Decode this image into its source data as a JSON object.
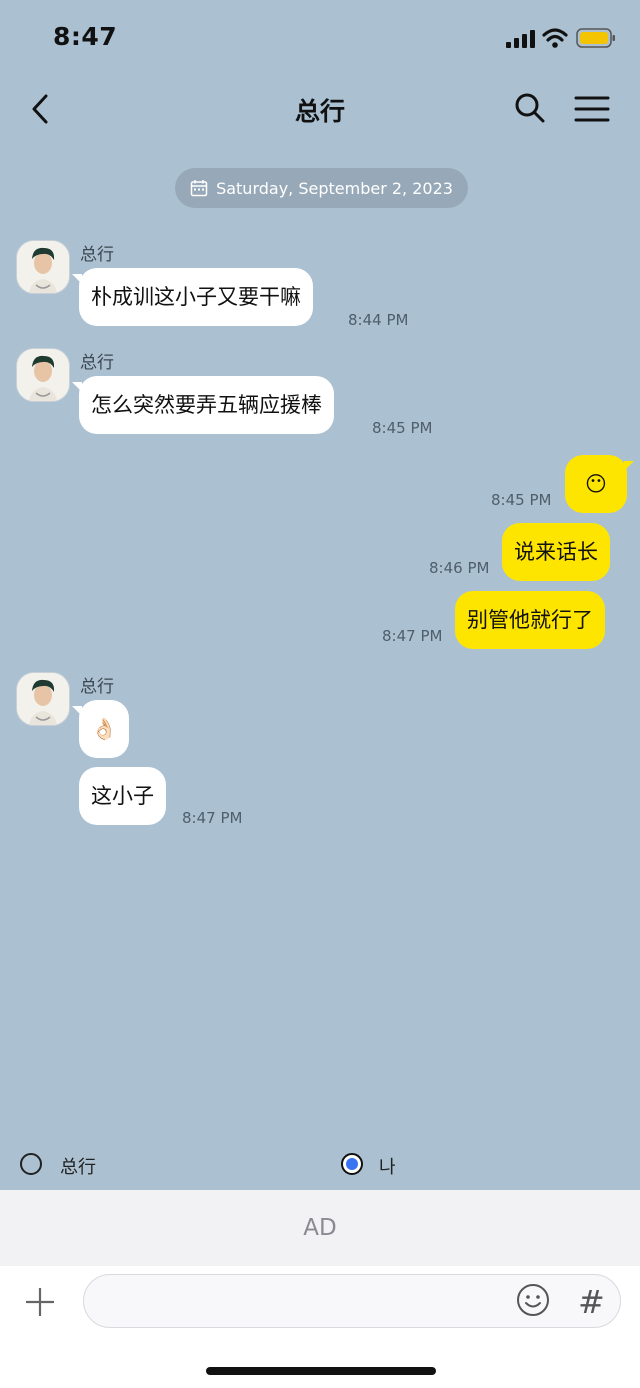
{
  "status_bar": {
    "time": "8:47"
  },
  "header": {
    "title": "总行"
  },
  "date_divider": "Saturday, September 2, 2023",
  "messages": [
    {
      "sender": "总行",
      "text": "朴成训这小子又要干嘛",
      "time": "8:44 PM"
    },
    {
      "sender": "总行",
      "text": "怎么突然要弄五辆应援棒",
      "time": "8:45 PM"
    },
    {
      "sender": "me",
      "text": "😶",
      "time": "8:45 PM"
    },
    {
      "sender": "me",
      "text": "说来话长",
      "time": "8:46 PM"
    },
    {
      "sender": "me",
      "text": "别管他就行了",
      "time": "8:47 PM"
    },
    {
      "sender": "总行",
      "text": "👌🏻",
      "time": ""
    },
    {
      "sender": "总行",
      "text": "这小子",
      "time": "8:47 PM"
    }
  ],
  "speaker_select": {
    "option_other": "总行",
    "option_me": "나",
    "selected": "나"
  },
  "ad_label": "AD",
  "input": {
    "placeholder": ""
  },
  "colors": {
    "background": "#abc1d1",
    "my_bubble": "#fee500",
    "their_bubble": "#ffffff",
    "radio_selected": "#3874f2"
  }
}
